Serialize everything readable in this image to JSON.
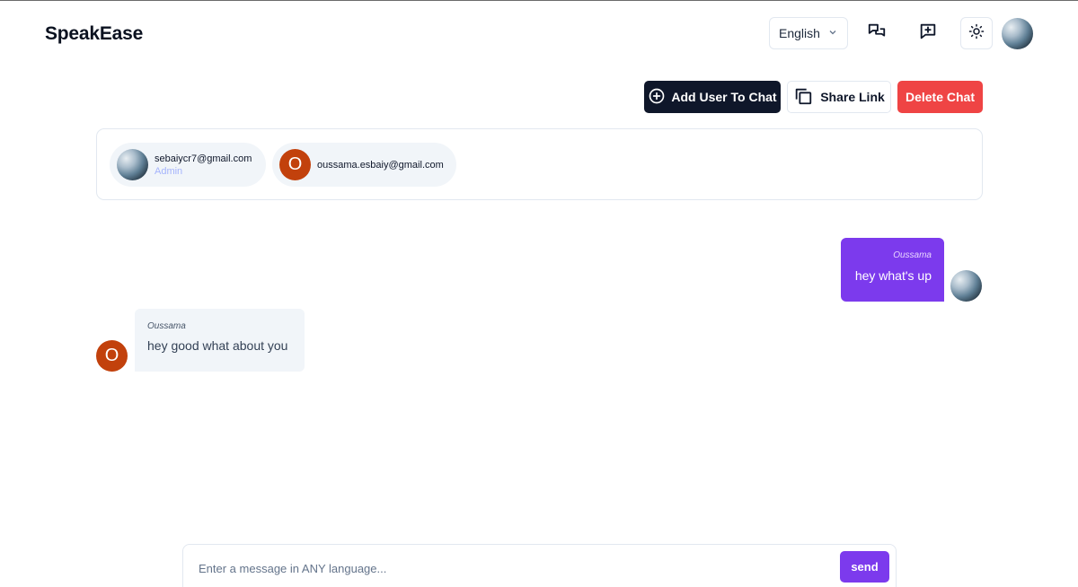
{
  "header": {
    "brand": "SpeakEase",
    "language": "English",
    "icons": [
      "chats-icon",
      "new-chat-icon",
      "sun-icon"
    ]
  },
  "actions": {
    "add_user": "Add User To Chat",
    "share_link": "Share Link",
    "delete_chat": "Delete Chat"
  },
  "participants": [
    {
      "email": "sebaiycr7@gmail.com",
      "role": "Admin"
    },
    {
      "email": "oussama.esbaiy@gmail.com",
      "initial": "O"
    }
  ],
  "messages": [
    {
      "direction": "outgoing",
      "sender": "Oussama",
      "text": "hey what's up"
    },
    {
      "direction": "incoming",
      "sender": "Oussama",
      "text": "hey good what about you",
      "initial": "O"
    }
  ],
  "composer": {
    "placeholder": "Enter a message in ANY language...",
    "send_label": "send"
  },
  "colors": {
    "primary": "#7c3aed",
    "dark": "#0f172a",
    "danger": "#ef4444",
    "avatar_letter": "#c2410c"
  }
}
